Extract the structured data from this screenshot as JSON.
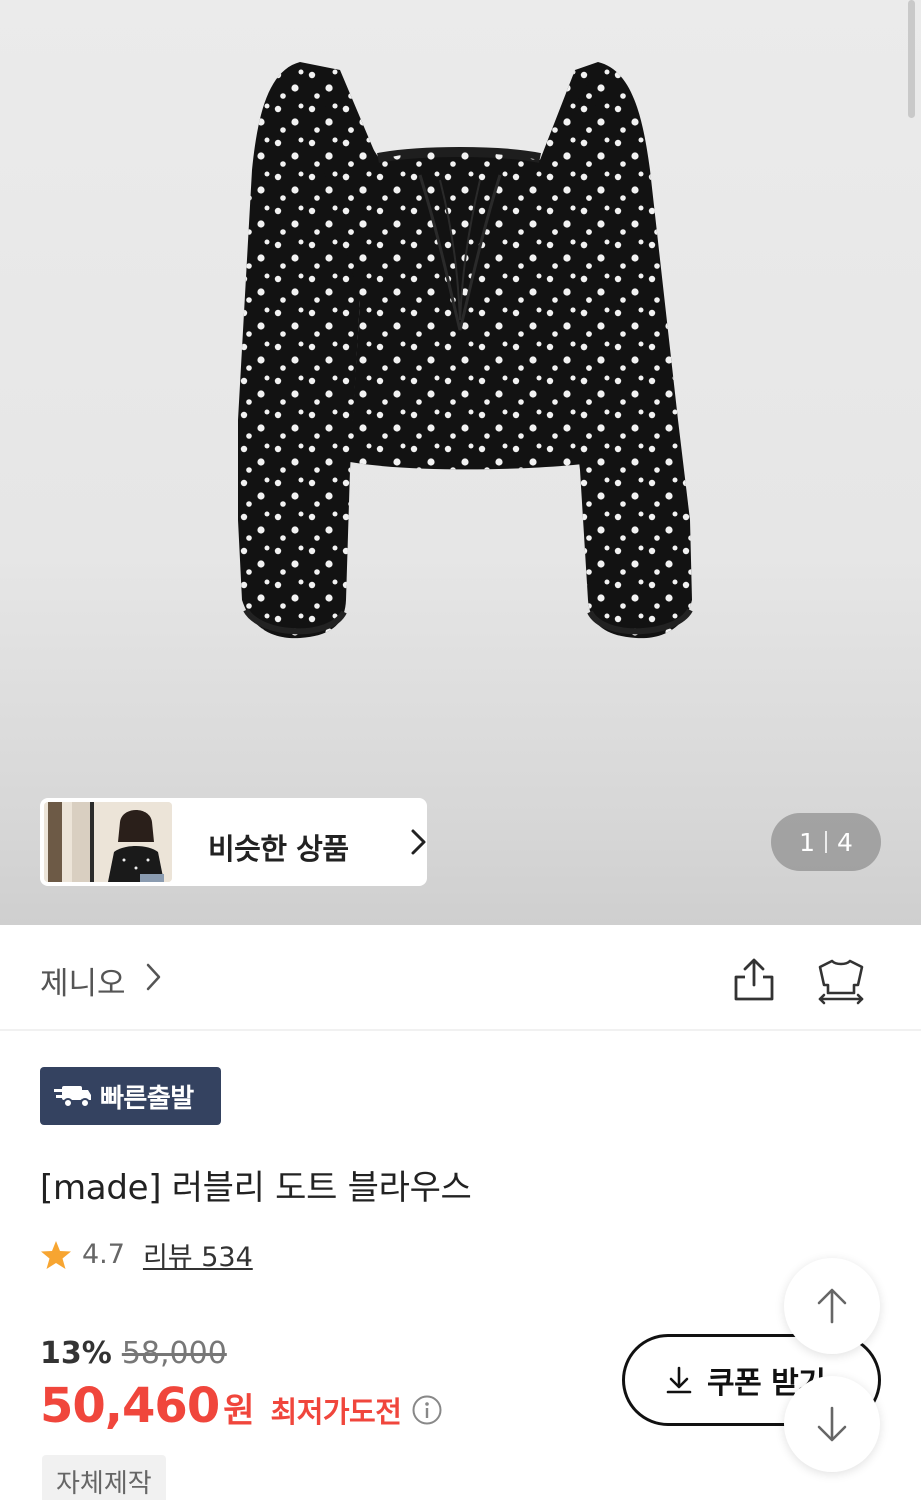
{
  "hero": {
    "similar_label": "비슷한 상품",
    "pager_current": "1",
    "pager_total": "4"
  },
  "brand": {
    "name": "제니오"
  },
  "product": {
    "badge": "빠른출발",
    "title": "[made] 러블리 도트 블라우스",
    "rating": "4.7",
    "review_label": "리뷰 534",
    "discount_pct": "13%",
    "original_price": "58,000",
    "price": "50,460",
    "price_unit": "원",
    "lowest_label": "최저가도전",
    "tag": "자체제작"
  },
  "actions": {
    "coupon_label": "쿠폰 받기"
  },
  "colors": {
    "accent_red": "#f0463c",
    "badge_navy": "#344260"
  }
}
